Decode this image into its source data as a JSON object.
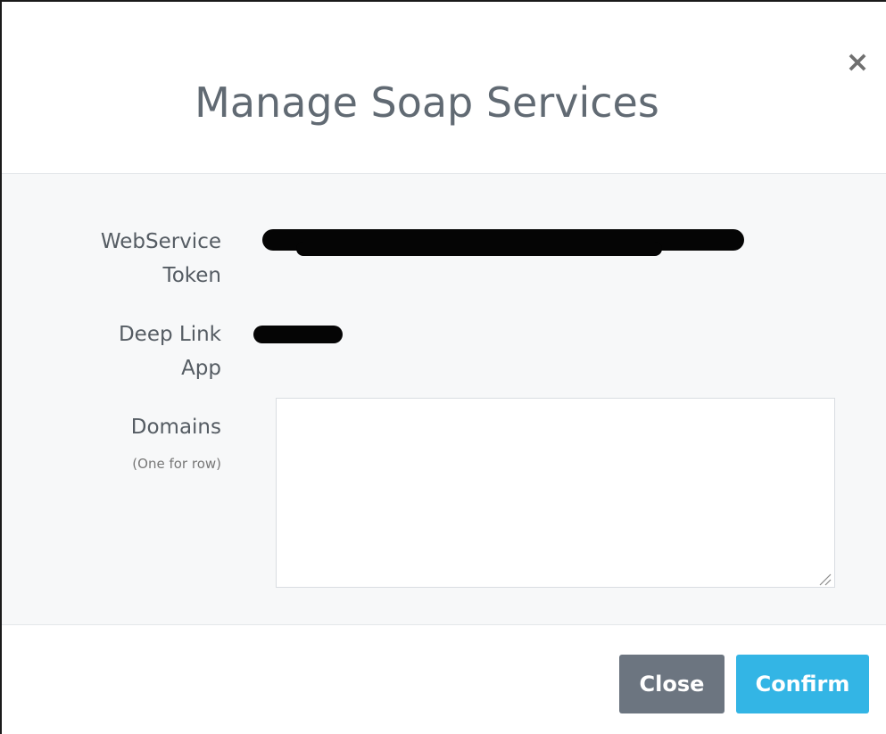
{
  "modal": {
    "title": "Manage Soap Services",
    "close_icon": "close-icon"
  },
  "form": {
    "webservice_token_label_line1": "WebService",
    "webservice_token_label_line2": "Token",
    "deep_link_label_line1": "Deep Link",
    "deep_link_label_line2": "App",
    "domains_label": "Domains",
    "domains_hint": "(One for row)",
    "domains_value": ""
  },
  "footer": {
    "close_label": "Close",
    "confirm_label": "Confirm"
  },
  "colors": {
    "confirm": "#33b5e5",
    "close": "#6c7580",
    "body_bg": "#f7f8f9"
  }
}
